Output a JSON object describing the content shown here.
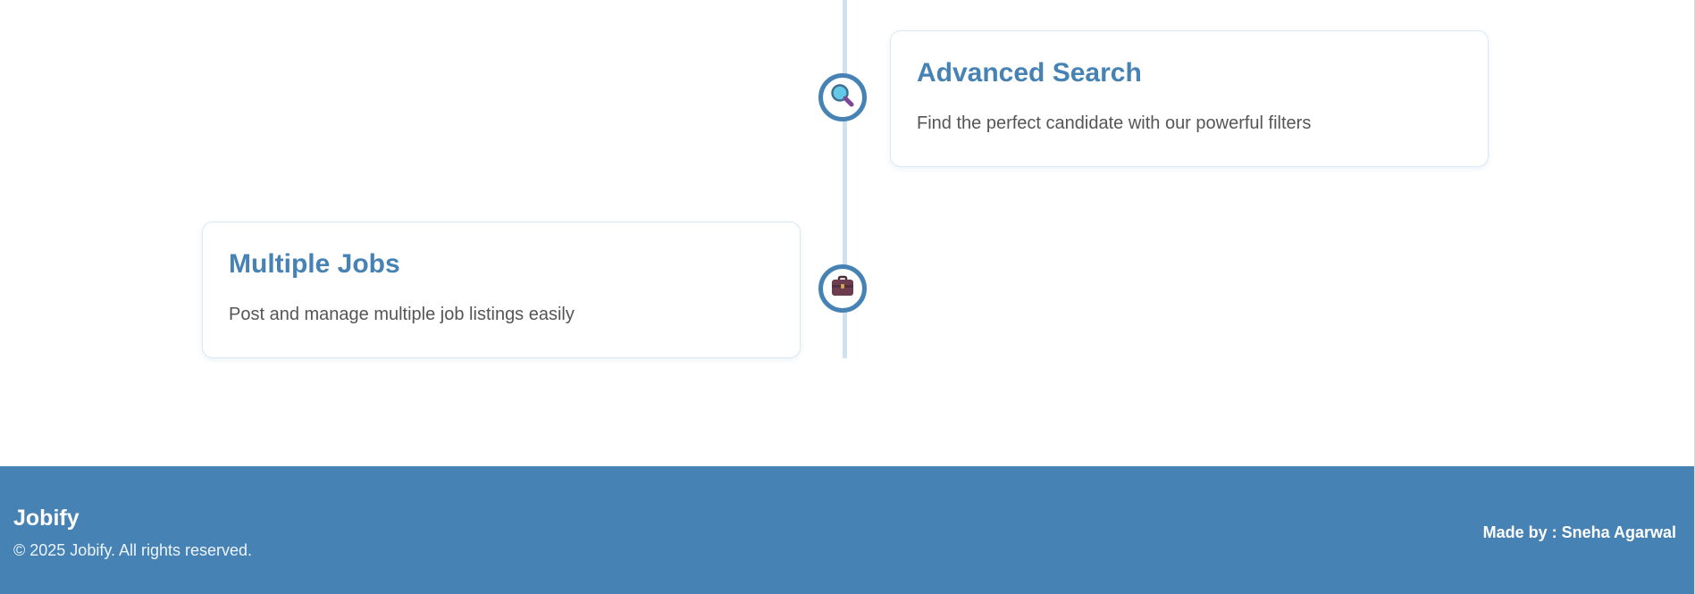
{
  "timeline": {
    "items": [
      {
        "title": "Advanced Search",
        "description": "Find the perfect candidate with our powerful filters",
        "icon": "magnifying-glass-icon"
      },
      {
        "title": "Multiple Jobs",
        "description": "Post and manage multiple job listings easily",
        "icon": "briefcase-icon"
      }
    ]
  },
  "footer": {
    "brand": "Jobify",
    "copyright": "© 2025 Jobify. All rights reserved.",
    "credit": "Made by : Sneha Agarwal"
  },
  "colors": {
    "primary": "#4682b4",
    "timeline_line": "#cfe0ef",
    "card_border": "#d9e8f4",
    "description_text": "#555555",
    "footer_text": "#ffffff"
  }
}
